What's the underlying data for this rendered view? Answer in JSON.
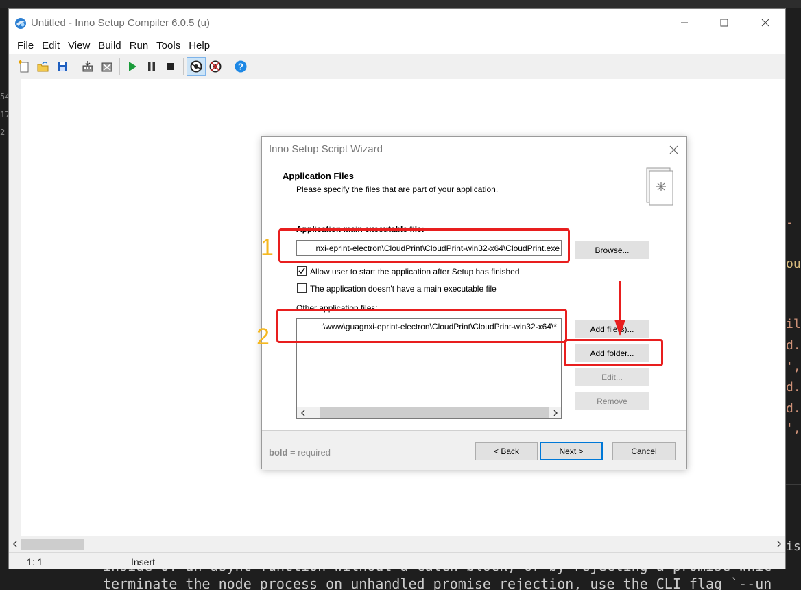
{
  "background": {
    "gutter_numbers": [
      "54",
      "17",
      "",
      "2"
    ],
    "code_fragments": [
      {
        "text": "-",
        "color": "#ce9178"
      },
      {
        "text": "out",
        "color": "#d7ba7d"
      },
      {
        "text": "ile",
        "color": "#ce9178"
      },
      {
        "text": "d.j",
        "color": "#ce9178"
      },
      {
        "text": "',",
        "color": "#ce9178"
      },
      {
        "text": "d.j",
        "color": "#ce9178"
      },
      {
        "text": "d.j",
        "color": "#ce9178"
      },
      {
        "text": "',",
        "color": "#ce9178"
      },
      {
        "text": "is",
        "color": "#cccccc"
      }
    ],
    "terminal_lines": [
      "inside of an async function without a catch block, or by rejecting a promise whic",
      "terminate the node process on unhandled promise rejection, use the CLI flag `--un"
    ]
  },
  "app": {
    "title": "Untitled - Inno Setup Compiler 6.0.5 (u)",
    "menu": [
      "File",
      "Edit",
      "View",
      "Build",
      "Run",
      "Tools",
      "Help"
    ],
    "toolbar_icons": [
      "new-file-icon",
      "open-file-icon",
      "save-icon",
      "compile-icon",
      "stop-compile-icon",
      "run-icon",
      "pause-icon",
      "stop-icon",
      "target-icon",
      "uninstall-icon",
      "help-icon"
    ],
    "status": {
      "position": "1:  1",
      "mode": "Insert"
    }
  },
  "wizard": {
    "title": "Inno Setup Script Wizard",
    "header_title": "Application Files",
    "header_subtitle": "Please specify the files that are part of your application.",
    "main_exe_label": "Application main executable file:",
    "main_exe_value": "nxi-eprint-electron\\CloudPrint\\CloudPrint-win32-x64\\CloudPrint.exe",
    "browse_label": "Browse...",
    "allow_start_label": "Allow user to start the application after Setup has finished",
    "allow_start_checked": true,
    "no_main_exe_label": "The application doesn't have a main executable file",
    "no_main_exe_checked": false,
    "other_files_label": "Other application files:",
    "other_files": [
      ":\\www\\guagnxi-eprint-electron\\CloudPrint\\CloudPrint-win32-x64\\*"
    ],
    "add_files_label": "Add file(s)...",
    "add_folder_label": "Add folder...",
    "edit_label": "Edit...",
    "remove_label": "Remove",
    "legend_bold": "bold",
    "legend_rest": " = required",
    "back_label": "< Back",
    "next_label": "Next >",
    "cancel_label": "Cancel"
  },
  "annotations": {
    "marker_1": "1",
    "marker_2": "2",
    "color": "#e81e1e",
    "number_color": "#f5b820"
  }
}
